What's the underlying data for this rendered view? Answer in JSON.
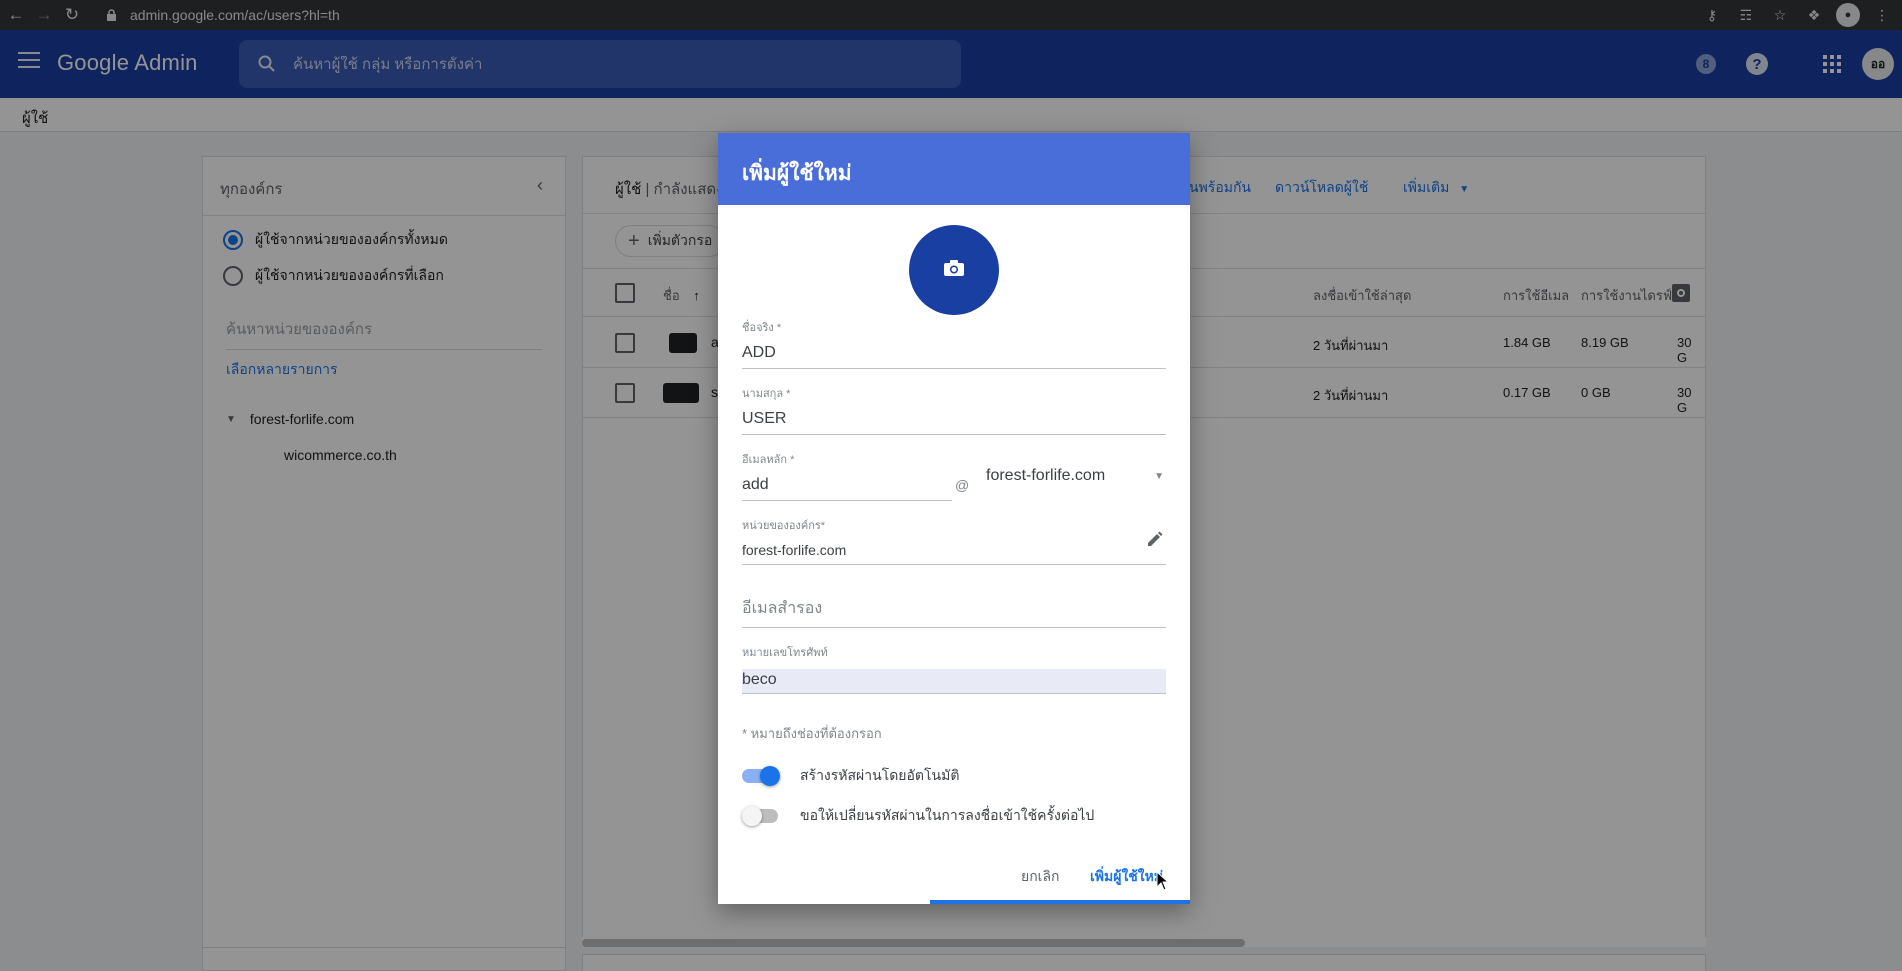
{
  "browser": {
    "url": "admin.google.com/ac/users?hl=th"
  },
  "header": {
    "logo": "Google Admin",
    "search_placeholder": "ค้นหาผู้ใช้ กลุ่ม หรือการตั้งค่า",
    "notification_count": "8",
    "help_label": "?",
    "avatar_initials": "ออ"
  },
  "breadcrumb": {
    "current": "ผู้ใช้"
  },
  "sidebar": {
    "title": "ทุกองค์กร",
    "options": [
      {
        "label": "ผู้ใช้จากหน่วยขององค์กรทั้งหมด",
        "selected": true
      },
      {
        "label": "ผู้ใช้จากหน่วยขององค์กรที่เลือก",
        "selected": false
      }
    ],
    "search_placeholder": "ค้นหาหน่วยขององค์กร",
    "multi_select_link": "เลือกหลายรายการ",
    "org_root": "forest-forlife.com",
    "org_child": "wicommerce.co.th"
  },
  "main": {
    "title": "ผู้ใช้",
    "subtitle": "| กำลังแสดง",
    "actions": [
      "นพร้อมกัน",
      "ดาวน์โหลดผู้ใช้",
      "เพิ่มเติม"
    ],
    "filter_chip": "เพิ่มตัวกรอ",
    "columns": {
      "name": "ชื่อ",
      "last_signin": "ลงชื่อเข้าใช้ล่าสุด",
      "email_usage": "การใช้อีเมล",
      "drive_usage": "การใช้งานไดรฟ์"
    },
    "rows": [
      {
        "initial": "a",
        "last_signin": "2 วันที่ผ่านมา",
        "email_usage": "1.84 GB",
        "drive_usage": "8.19 GB",
        "quota": "30 G"
      },
      {
        "initial": "s",
        "last_signin": "2 วันที่ผ่านมา",
        "email_usage": "0.17 GB",
        "drive_usage": "0 GB",
        "quota": "30 G"
      }
    ],
    "scroll_fraction": 0.59
  },
  "dialog": {
    "title": "เพิ่มผู้ใช้ใหม่",
    "first_name": {
      "label": "ชื่อจริง *",
      "value": "ADD"
    },
    "last_name": {
      "label": "นามสกุล *",
      "value": "USER"
    },
    "primary_email": {
      "label": "อีเมลหลัก *",
      "value": "add",
      "at": "@",
      "domain": "forest-forlife.com"
    },
    "org_unit": {
      "label": "หน่วยขององค์กร*",
      "value": "forest-forlife.com"
    },
    "secondary_email": {
      "placeholder": "อีเมลสำรอง"
    },
    "phone": {
      "label": "หมายเลขโทรศัพท์",
      "value": "beco"
    },
    "required_note": "* หมายถึงช่องที่ต้องกรอก",
    "toggles": [
      {
        "label": "สร้างรหัสผ่านโดยอัตโนมัติ",
        "on": true
      },
      {
        "label": "ขอให้เปลี่ยนรหัสผ่านในการลงชื่อเข้าใช้ครั้งต่อไป",
        "on": false
      }
    ],
    "cancel_label": "ยกเลิก",
    "submit_label": "เพิ่มผู้ใช้ใหม่",
    "progress_fraction": 0.55
  }
}
